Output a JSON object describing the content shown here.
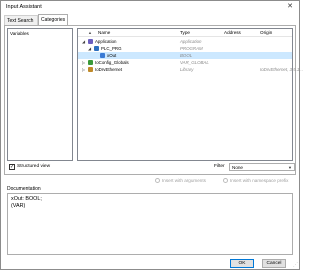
{
  "window": {
    "title": "Input Assistant",
    "close_glyph": "✕"
  },
  "tabs": [
    {
      "label": "Text Search",
      "active": false
    },
    {
      "label": "Categories",
      "active": true
    }
  ],
  "categories": {
    "items": [
      "Variables"
    ]
  },
  "tree": {
    "columns": {
      "name": "Name",
      "type": "Type",
      "address": "Address",
      "origin": "Origin"
    },
    "rows": [
      {
        "toggle": "◢",
        "icon": "application-icon",
        "icon_color": "#6b5fbf",
        "name": "Application",
        "type": "Application",
        "address": "",
        "origin": "",
        "selected": false
      },
      {
        "toggle": "◢",
        "icon": "program-icon",
        "icon_color": "#2c6fbf",
        "name": "PLC_PRG",
        "type": "PROGRAM",
        "address": "",
        "origin": "",
        "selected": false
      },
      {
        "toggle": "",
        "icon": "variable-icon",
        "icon_color": "#3a7bd5",
        "name": "xOut",
        "type": "BOOL",
        "address": "",
        "origin": "",
        "selected": true
      },
      {
        "toggle": "▷",
        "icon": "gvl-icon",
        "icon_color": "#3a9a3a",
        "name": "IoConfig_Globals",
        "type": "VAR_GLOBAL",
        "address": "",
        "origin": "",
        "selected": false
      },
      {
        "toggle": "▷",
        "icon": "library-icon",
        "icon_color": "#c08a2a",
        "name": "IoDrvEthernet",
        "type": "Library",
        "address": "",
        "origin": "IoDrvEthernet, 3.5.1...",
        "selected": false
      }
    ]
  },
  "options": {
    "structured_view": {
      "label": "Structured view",
      "checked": true
    },
    "filter": {
      "label": "Filter",
      "value": "None"
    },
    "insert_with_arguments": {
      "label": "Insert with arguments",
      "enabled": false
    },
    "insert_with_namespace": {
      "label": "Insert with namespace prefix",
      "enabled": false
    }
  },
  "documentation": {
    "label": "Documentation",
    "lines": [
      "xOut: BOOL;",
      "(VAR)"
    ]
  },
  "buttons": {
    "ok": "OK",
    "cancel": "Cancel"
  },
  "colors": {
    "selection": "#cce8ff",
    "ok_border": "#0078d7"
  }
}
